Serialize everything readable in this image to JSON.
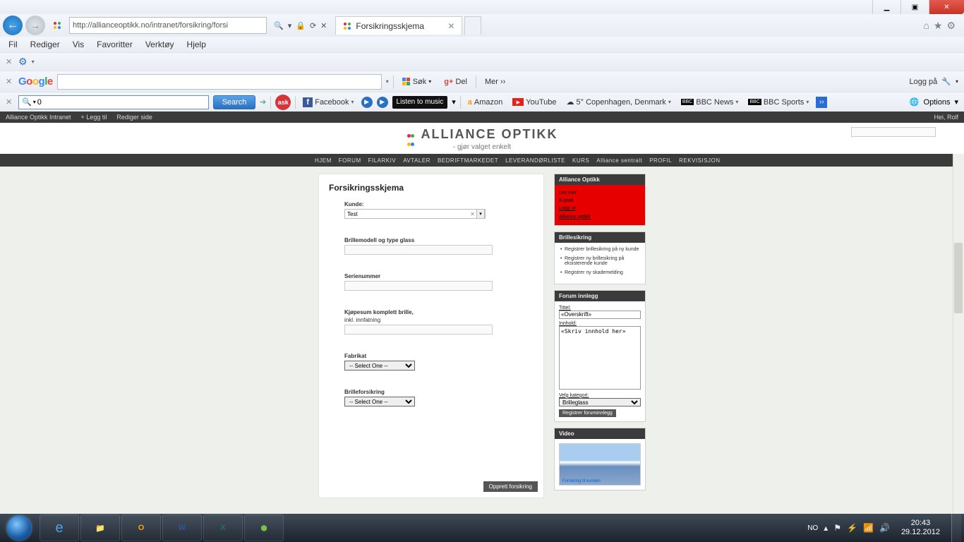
{
  "window": {
    "url_display": "http://allianceoptikk.no/intranet/forsikring/forsi",
    "tab_title": "Forsikringsskjema",
    "win_min": "▁",
    "win_max": "▣",
    "win_close": "✕"
  },
  "nav_icons": {
    "back": "←",
    "fwd": "→",
    "search": "🔍",
    "refresh": "⟳",
    "stop": "✕",
    "dd": "▾"
  },
  "menus": {
    "fil": "Fil",
    "rediger": "Rediger",
    "vis": "Vis",
    "favoritter": "Favoritter",
    "verktoy": "Verktøy",
    "hjelp": "Hjelp"
  },
  "right_icons": {
    "home": "⌂",
    "star": "★",
    "gear": "⚙"
  },
  "google": {
    "sok": "Søk",
    "del": "Del",
    "mer": "Mer ››",
    "logg": "Logg på",
    "wrench": "🔧"
  },
  "askbar": {
    "q_value": "0",
    "search": "Search",
    "ask": "ask",
    "facebook": "Facebook",
    "listen": "Listen to music",
    "amazon": "Amazon",
    "youtube": "YouTube",
    "weather": "5° Copenhagen, Denmark",
    "bbcnews": "BBC News",
    "bbcsports": "BBC Sports",
    "options": "Options",
    "more": "››"
  },
  "intranet": {
    "title": "Alliance Optikk Intranet",
    "add": "+  Legg til",
    "edit": "Rediger side",
    "user": "Hei, Rolf"
  },
  "site": {
    "brand": "ALLIANCE OPTIKK",
    "tagline": "- gjør valget enkelt",
    "nav": {
      "hjem": "HJEM",
      "forum": "FORUM",
      "filarkiv": "FILARKIV",
      "avtaler": "AVTALER",
      "bedrift": "BEDRIFTMARKEDET",
      "lev": "LEVERANDØRLISTE",
      "kurs": "KURS",
      "sentral": "Alliance sentralt",
      "profil": "PROFIL",
      "rekv": "REKVISISJON"
    }
  },
  "form": {
    "title": "Forsikringsskjema",
    "kunde_label": "Kunde:",
    "kunde_value": "Test",
    "brille_label": "Brillemodell og type glass",
    "serie_label": "Serienummer",
    "kjop_label1": "Kjøpesum komplett brille,",
    "kjop_label2": "inkl. innfatning",
    "fabrikat_label": "Fabrikat",
    "forsikring_label": "Brilleforsikring",
    "select_placeholder": "-- Select One --",
    "submit": "Opprett forsikring"
  },
  "sidebar": {
    "box1_title": "Alliance Optikk",
    "red": {
      "l1": "Les mer",
      "l2": "E-post",
      "l3": "Logg ut",
      "l4": "Alliance optikk"
    },
    "box2_title": "Brillesikring",
    "box2_items": {
      "i1": "Registrer brillesikring på ny kunde",
      "i2": "Registrer ny brillesikring på eksisterende kunde",
      "i3": "Registrer ny skademelding"
    },
    "box3_title": "Forum innlegg",
    "forum": {
      "tittel_label": "Tittel:",
      "tittel_value": "«Overskrift»",
      "innhold_label": "Innhold:",
      "innhold_value": "«Skriv innhold her»",
      "kategori_label": "Velg kategori:",
      "kategori_value": "Brilleglass",
      "reg": "Registrer foruminnlegg"
    },
    "box4_title": "Video",
    "video_caption": "Forsikring til kunden"
  },
  "taskbar": {
    "lang": "NO",
    "time": "20:43",
    "date": "29.12.2012",
    "up": "▴",
    "flag": "⚑",
    "speaker": "🔊",
    "wifi": "▮",
    "power": "⚡"
  }
}
